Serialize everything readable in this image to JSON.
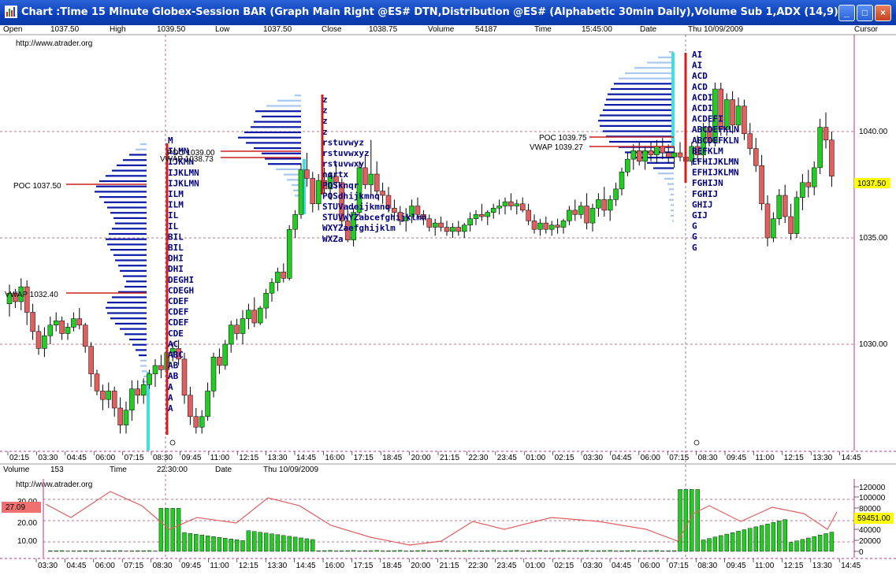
{
  "window": {
    "title": "Chart :Time 15 Minute Globex-Session BAR (Graph Main Right @ES# DTN,Distribution @ES# (Alphabetic 30min Daily),Volume Sub 1,ADX (14,9))",
    "minimize": "_",
    "maximize": "□",
    "close": "×"
  },
  "infobar": {
    "open_label": "Open",
    "open_value": "1037.50",
    "high_label": "High",
    "high_value": "1039.50",
    "low_label": "Low",
    "low_value": "1037.50",
    "close_label": "Close",
    "close_value": "1038.75",
    "volume_label": "Volume",
    "volume_value": "54187",
    "time_label": "Time",
    "time_value": "15:45:00",
    "date_label": "Date",
    "date_value": "Thu 10/09/2009",
    "cursor_label": "Cursor"
  },
  "main_panel": {
    "watermark": "http://www.atrader.org",
    "price_axis": [
      "1040.00",
      "1035.00",
      "1030.00"
    ],
    "last_price": "1037.50",
    "poc_labels": [
      "POC 1037.50",
      "POC 1039.00",
      "POC 1039.75"
    ],
    "vwap_labels": [
      "VWAP 1032.40",
      "VWAP 1038.73",
      "VWAP 1039.27"
    ],
    "profile1_letters": [
      "M",
      "ILMN",
      "IJKMN",
      "IJKLMN",
      "IJKLMN",
      "ILM",
      "ILM",
      "IL",
      "IL",
      "BIL",
      "BIL",
      "DHI",
      "DHI",
      "DEGHI",
      "CDEGH",
      "CDEF",
      "CDEF",
      "CDEF",
      "CDE",
      "AC",
      "ABC",
      "AB",
      "AB",
      "A",
      "A",
      "A"
    ],
    "profile2_letters": [
      "z",
      "z",
      "z",
      "z",
      "rstuvwyz",
      "rstuvwxyz",
      "rstuvwxy",
      "nqrtx",
      "PQSknqr",
      "PQSdhijkmnq",
      "STUVadeijkmnq",
      "STUVWYZabcefghijklmn",
      "WXYZaefghijklm",
      "WXZa"
    ],
    "profile3_letters": [
      "AI",
      "AI",
      "ACD",
      "ACD",
      "ACDI",
      "ACDI",
      "ACDEFI",
      "ABCDEFKLN",
      "ABCDEFKLN",
      "BEFKLM",
      "EFHIJKLMN",
      "EFHIJKLMN",
      "FGHIJN",
      "FGHIJ",
      "GHIJ",
      "GIJ",
      "G",
      "G",
      "G"
    ],
    "time_axis": [
      "02:15",
      "03:30",
      "04:45",
      "06:00",
      "07:15",
      "08:30",
      "09:45",
      "11:00",
      "12:15",
      "13:30",
      "14:45",
      "16:00",
      "17:15",
      "18:45",
      "20:00",
      "21:15",
      "22:30",
      "23:45",
      "01:00",
      "02:15",
      "03:30",
      "04:45",
      "06:00",
      "07:15",
      "08:30",
      "09:45",
      "11:00",
      "12:15",
      "13:30",
      "14:45"
    ]
  },
  "sub_panel": {
    "volume_label": "Volume",
    "volume_value": "153",
    "time_label": "Time",
    "time_value": "22:30:00",
    "date_label": "Date",
    "date_value": "Thu 10/09/2009",
    "watermark": "http://www.atrader.org",
    "adx_axis": [
      "30.00",
      "20.00",
      "10.00"
    ],
    "adx_value": "27.09",
    "volume_axis": [
      "120000",
      "100000",
      "80000",
      "60000",
      "40000",
      "20000",
      "0"
    ],
    "volume_last": "59451.00",
    "time_axis": [
      "03:30",
      "04:45",
      "06:00",
      "07:15",
      "08:30",
      "09:45",
      "11:00",
      "12:15",
      "13:30",
      "14:45",
      "16:00",
      "17:15",
      "18:45",
      "20:00",
      "21:15",
      "22:30",
      "23:45",
      "01:00",
      "02:15",
      "03:30",
      "04:45",
      "06:00",
      "07:15",
      "08:30",
      "09:45",
      "11:00",
      "12:15",
      "13:30",
      "14:45"
    ]
  },
  "colors": {
    "titlebar": "#0a3fb8",
    "bull_candle": "#22cc22",
    "bear_candle": "#e06060",
    "profile_dark": "#0a1aa8",
    "profile_light": "#a8c8f0",
    "poc_line": "#cc2020",
    "grid": "#a05070",
    "last_price_bg": "#ffff00"
  },
  "chart_data": {
    "type": "candlestick",
    "ylim": [
      1025.5,
      1042.5
    ],
    "candles": [
      [
        1031.9,
        1032.8,
        1031.3,
        1032.4
      ],
      [
        1032.4,
        1032.6,
        1031.7,
        1032.0
      ],
      [
        1032.0,
        1033.1,
        1031.6,
        1032.7
      ],
      [
        1032.7,
        1033.0,
        1030.9,
        1031.5
      ],
      [
        1031.5,
        1031.9,
        1030.2,
        1030.6
      ],
      [
        1030.6,
        1030.9,
        1029.5,
        1029.8
      ],
      [
        1029.8,
        1030.8,
        1029.4,
        1030.4
      ],
      [
        1030.4,
        1031.3,
        1030.0,
        1030.9
      ],
      [
        1030.9,
        1031.5,
        1030.6,
        1031.1
      ],
      [
        1031.1,
        1031.3,
        1030.2,
        1030.5
      ],
      [
        1030.5,
        1031.0,
        1030.2,
        1030.8
      ],
      [
        1030.8,
        1031.5,
        1030.6,
        1031.2
      ],
      [
        1031.2,
        1031.7,
        1030.7,
        1030.9
      ],
      [
        1030.9,
        1031.0,
        1029.6,
        1029.9
      ],
      [
        1029.9,
        1030.1,
        1028.0,
        1028.6
      ],
      [
        1028.6,
        1028.8,
        1027.6,
        1027.8
      ],
      [
        1027.8,
        1028.1,
        1026.9,
        1027.4
      ],
      [
        1027.4,
        1028.2,
        1027.0,
        1027.8
      ],
      [
        1027.8,
        1028.0,
        1026.6,
        1027.0
      ],
      [
        1027.0,
        1027.5,
        1025.8,
        1026.2
      ],
      [
        1026.2,
        1027.3,
        1025.8,
        1026.9
      ],
      [
        1026.9,
        1028.3,
        1026.4,
        1027.9
      ],
      [
        1027.9,
        1028.3,
        1027.2,
        1027.6
      ],
      [
        1027.6,
        1028.4,
        1027.2,
        1028.1
      ],
      [
        1028.1,
        1028.8,
        1027.9,
        1028.6
      ],
      [
        1028.6,
        1029.3,
        1028.0,
        1029.0
      ],
      [
        1029.0,
        1029.5,
        1028.4,
        1028.8
      ],
      [
        1028.8,
        1029.8,
        1028.5,
        1029.6
      ],
      [
        1029.6,
        1030.1,
        1029.2,
        1029.8
      ],
      [
        1029.8,
        1030.2,
        1029.0,
        1029.3
      ],
      [
        1029.3,
        1029.6,
        1027.2,
        1027.6
      ],
      [
        1027.6,
        1028.0,
        1026.2,
        1026.6
      ],
      [
        1026.6,
        1027.0,
        1025.8,
        1026.1
      ],
      [
        1026.1,
        1026.9,
        1025.8,
        1026.6
      ],
      [
        1026.6,
        1028.2,
        1026.4,
        1027.8
      ],
      [
        1027.8,
        1029.6,
        1027.5,
        1029.4
      ],
      [
        1029.4,
        1029.8,
        1028.6,
        1029.0
      ],
      [
        1029.0,
        1030.2,
        1028.8,
        1030.0
      ],
      [
        1030.0,
        1031.1,
        1029.6,
        1030.9
      ],
      [
        1030.9,
        1031.2,
        1030.2,
        1030.5
      ],
      [
        1030.5,
        1031.6,
        1030.0,
        1031.2
      ],
      [
        1031.2,
        1031.9,
        1030.7,
        1031.6
      ],
      [
        1031.6,
        1032.2,
        1030.8,
        1031.0
      ],
      [
        1031.0,
        1031.8,
        1030.9,
        1031.7
      ],
      [
        1031.7,
        1032.6,
        1031.2,
        1032.4
      ],
      [
        1032.4,
        1033.1,
        1032.0,
        1032.9
      ],
      [
        1032.9,
        1033.6,
        1032.5,
        1033.4
      ],
      [
        1033.4,
        1033.8,
        1032.9,
        1033.1
      ],
      [
        1033.1,
        1035.6,
        1033.0,
        1035.4
      ],
      [
        1035.4,
        1036.3,
        1035.0,
        1036.1
      ],
      [
        1036.1,
        1038.5,
        1035.9,
        1038.2
      ],
      [
        1038.2,
        1039.0,
        1037.4,
        1037.8
      ],
      [
        1037.8,
        1038.1,
        1036.2,
        1036.6
      ],
      [
        1036.6,
        1038.0,
        1036.3,
        1037.7
      ],
      [
        1037.7,
        1038.3,
        1037.1,
        1037.3
      ],
      [
        1037.3,
        1038.1,
        1036.8,
        1037.9
      ],
      [
        1037.9,
        1038.5,
        1037.3,
        1037.6
      ],
      [
        1037.6,
        1037.8,
        1035.5,
        1035.8
      ],
      [
        1035.8,
        1036.5,
        1034.8,
        1034.9
      ],
      [
        1034.9,
        1036.4,
        1034.6,
        1036.2
      ],
      [
        1036.2,
        1038.6,
        1036.0,
        1038.3
      ],
      [
        1038.3,
        1038.9,
        1037.3,
        1037.5
      ],
      [
        1037.5,
        1039.6,
        1037.0,
        1038.0
      ],
      [
        1038.0,
        1038.6,
        1037.0,
        1037.2
      ],
      [
        1037.2,
        1037.6,
        1036.6,
        1037.0
      ],
      [
        1037.0,
        1037.4,
        1036.2,
        1036.4
      ],
      [
        1036.4,
        1036.8,
        1035.8,
        1036.2
      ],
      [
        1036.2,
        1036.5,
        1035.6,
        1035.8
      ],
      [
        1035.8,
        1036.4,
        1035.3,
        1036.0
      ],
      [
        1036.0,
        1036.8,
        1035.7,
        1036.5
      ],
      [
        1036.5,
        1036.9,
        1035.9,
        1036.1
      ],
      [
        1036.1,
        1036.3,
        1035.6,
        1035.9
      ],
      [
        1035.9,
        1036.1,
        1035.3,
        1035.5
      ],
      [
        1035.5,
        1035.9,
        1035.1,
        1035.7
      ],
      [
        1035.7,
        1036.0,
        1035.3,
        1035.5
      ],
      [
        1035.5,
        1035.8,
        1035.1,
        1035.3
      ],
      [
        1035.3,
        1035.7,
        1035.0,
        1035.5
      ],
      [
        1035.5,
        1035.8,
        1035.1,
        1035.3
      ],
      [
        1035.3,
        1035.7,
        1035.0,
        1035.6
      ],
      [
        1035.6,
        1036.2,
        1035.3,
        1035.9
      ],
      [
        1035.9,
        1036.3,
        1035.6,
        1036.1
      ],
      [
        1036.1,
        1036.6,
        1035.8,
        1036.0
      ],
      [
        1036.0,
        1036.3,
        1035.6,
        1036.2
      ],
      [
        1036.2,
        1036.6,
        1035.9,
        1036.4
      ],
      [
        1036.4,
        1036.8,
        1036.1,
        1036.5
      ],
      [
        1036.5,
        1036.9,
        1036.1,
        1036.7
      ],
      [
        1036.7,
        1037.1,
        1036.3,
        1036.5
      ],
      [
        1036.5,
        1036.8,
        1036.1,
        1036.6
      ],
      [
        1036.6,
        1036.9,
        1036.2,
        1036.3
      ],
      [
        1036.3,
        1036.6,
        1035.6,
        1035.8
      ],
      [
        1035.8,
        1036.1,
        1035.2,
        1035.4
      ],
      [
        1035.4,
        1035.9,
        1035.1,
        1035.7
      ],
      [
        1035.7,
        1036.0,
        1035.2,
        1035.4
      ],
      [
        1035.4,
        1035.8,
        1035.1,
        1035.6
      ],
      [
        1035.6,
        1035.9,
        1035.2,
        1035.5
      ],
      [
        1035.5,
        1035.9,
        1035.2,
        1035.8
      ],
      [
        1035.8,
        1036.5,
        1035.6,
        1036.3
      ],
      [
        1036.3,
        1036.8,
        1035.8,
        1036.1
      ],
      [
        1036.1,
        1036.7,
        1035.9,
        1036.5
      ],
      [
        1036.5,
        1037.1,
        1035.4,
        1035.7
      ],
      [
        1035.7,
        1036.6,
        1035.3,
        1036.4
      ],
      [
        1036.4,
        1037.1,
        1036.0,
        1036.8
      ],
      [
        1036.8,
        1037.4,
        1036.0,
        1036.3
      ],
      [
        1036.3,
        1037.0,
        1035.8,
        1036.8
      ],
      [
        1036.8,
        1037.6,
        1036.5,
        1037.3
      ],
      [
        1037.3,
        1038.3,
        1037.0,
        1038.1
      ],
      [
        1038.1,
        1039.0,
        1037.9,
        1038.7
      ],
      [
        1038.7,
        1039.4,
        1038.2,
        1039.1
      ],
      [
        1039.1,
        1039.5,
        1038.4,
        1038.6
      ],
      [
        1038.6,
        1039.3,
        1038.2,
        1039.1
      ],
      [
        1039.1,
        1039.5,
        1038.6,
        1038.9
      ],
      [
        1038.9,
        1039.6,
        1038.5,
        1039.3
      ],
      [
        1039.3,
        1039.7,
        1038.7,
        1039.0
      ],
      [
        1039.0,
        1039.4,
        1038.5,
        1038.8
      ],
      [
        1038.8,
        1039.3,
        1038.3,
        1039.0
      ],
      [
        1039.0,
        1039.5,
        1038.6,
        1038.8
      ],
      [
        1038.8,
        1039.2,
        1038.3,
        1038.6
      ],
      [
        1038.6,
        1039.5,
        1038.4,
        1039.3
      ],
      [
        1039.3,
        1039.8,
        1038.6,
        1038.9
      ],
      [
        1038.9,
        1040.4,
        1038.7,
        1040.2
      ],
      [
        1040.2,
        1040.6,
        1039.3,
        1039.5
      ],
      [
        1039.5,
        1042.3,
        1039.3,
        1042.0
      ],
      [
        1042.0,
        1042.3,
        1039.8,
        1040.1
      ],
      [
        1040.1,
        1041.8,
        1039.8,
        1041.5
      ],
      [
        1041.5,
        1041.9,
        1039.9,
        1040.3
      ],
      [
        1040.3,
        1041.6,
        1040.0,
        1041.2
      ],
      [
        1041.2,
        1041.5,
        1039.6,
        1039.9
      ],
      [
        1039.9,
        1040.4,
        1038.9,
        1039.2
      ],
      [
        1039.2,
        1039.7,
        1038.1,
        1038.4
      ],
      [
        1038.4,
        1038.9,
        1036.3,
        1036.6
      ],
      [
        1036.6,
        1037.0,
        1034.6,
        1035.0
      ],
      [
        1035.0,
        1036.2,
        1034.8,
        1035.9
      ],
      [
        1035.9,
        1037.3,
        1035.6,
        1037.0
      ],
      [
        1037.0,
        1037.5,
        1035.7,
        1036.0
      ],
      [
        1036.0,
        1036.6,
        1034.9,
        1035.2
      ],
      [
        1035.2,
        1037.2,
        1035.0,
        1036.9
      ],
      [
        1036.9,
        1038.0,
        1036.3,
        1037.6
      ],
      [
        1037.6,
        1038.2,
        1036.9,
        1037.4
      ],
      [
        1037.4,
        1038.6,
        1037.0,
        1038.3
      ],
      [
        1038.3,
        1040.6,
        1038.0,
        1040.2
      ],
      [
        1040.2,
        1040.9,
        1039.2,
        1039.6
      ],
      [
        1039.6,
        1040.0,
        1037.4,
        1037.9
      ]
    ]
  }
}
